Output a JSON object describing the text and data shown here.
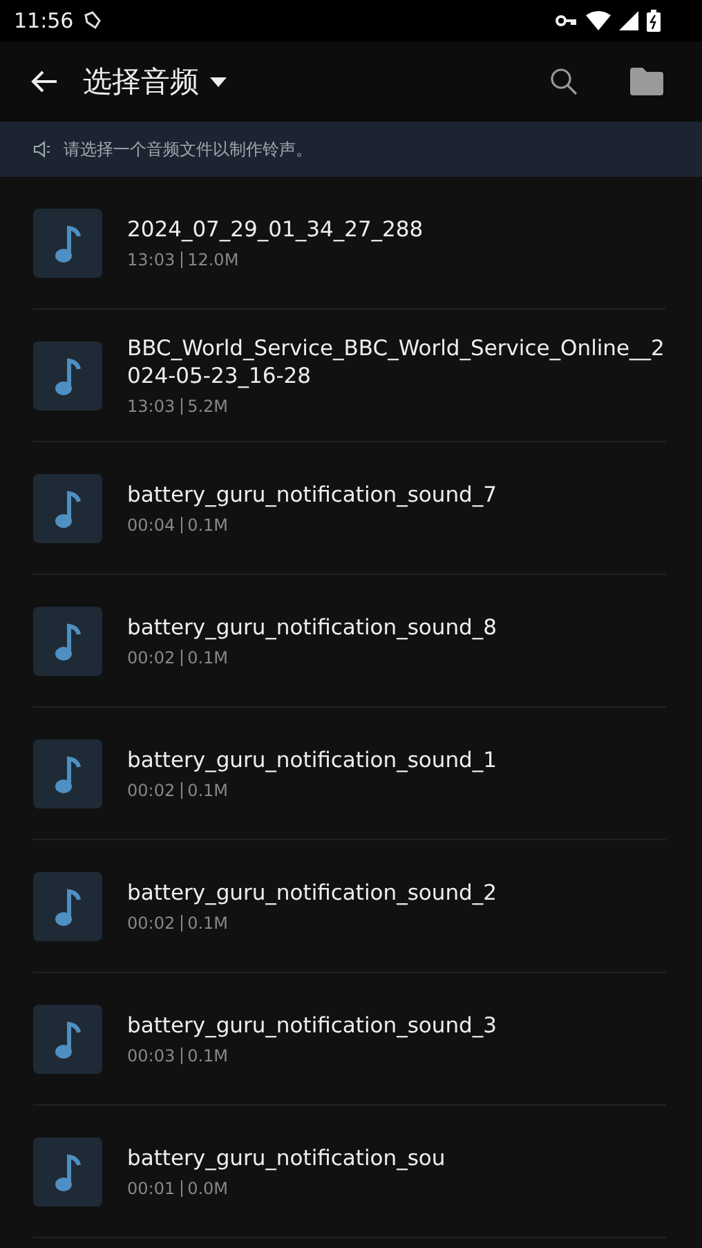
{
  "status_bar": {
    "time": "11:56"
  },
  "toolbar": {
    "title": "选择音频"
  },
  "banner": {
    "text": "请选择一个音频文件以制作铃声。"
  },
  "files": [
    {
      "name": "2024_07_29_01_34_27_288",
      "duration": "13:03",
      "size": "12.0M"
    },
    {
      "name": "BBC_World_Service_BBC_World_Service_Online__2024-05-23_16-28",
      "duration": "13:03",
      "size": "5.2M"
    },
    {
      "name": "battery_guru_notification_sound_7",
      "duration": "00:04",
      "size": "0.1M"
    },
    {
      "name": "battery_guru_notification_sound_8",
      "duration": "00:02",
      "size": "0.1M"
    },
    {
      "name": "battery_guru_notification_sound_1",
      "duration": "00:02",
      "size": "0.1M"
    },
    {
      "name": "battery_guru_notification_sound_2",
      "duration": "00:02",
      "size": "0.1M"
    },
    {
      "name": "battery_guru_notification_sound_3",
      "duration": "00:03",
      "size": "0.1M"
    },
    {
      "name": "battery_guru_notification_sou",
      "duration": "00:01",
      "size": "0.0M"
    }
  ]
}
